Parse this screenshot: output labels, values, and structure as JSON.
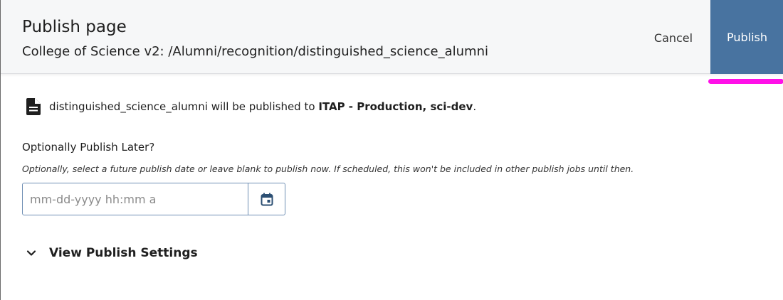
{
  "header": {
    "title": "Publish page",
    "subtitle": "College of Science v2: /Alumni/recognition/distinguished_science_alumni",
    "cancel_label": "Cancel",
    "publish_label": "Publish"
  },
  "notice": {
    "icon": "document-icon",
    "asset_name": "distinguished_science_alumni",
    "middle_text": " will be published to ",
    "destination": "ITAP - Production, sci-dev",
    "end_text": "."
  },
  "schedule": {
    "label": "Optionally Publish Later?",
    "help": "Optionally, select a future publish date or leave blank to publish now. If scheduled, this won't be included in other publish jobs until then.",
    "placeholder": "mm-dd-yyyy hh:mm a",
    "value": "",
    "icon": "calendar-icon"
  },
  "settings": {
    "label": "View Publish Settings",
    "icon": "chevron-down-icon"
  },
  "colors": {
    "publish_button": "#4873a0",
    "focus_indicator": "#ff10e8",
    "input_border": "#6f8fb4",
    "calendar_icon": "#2c4f73"
  }
}
